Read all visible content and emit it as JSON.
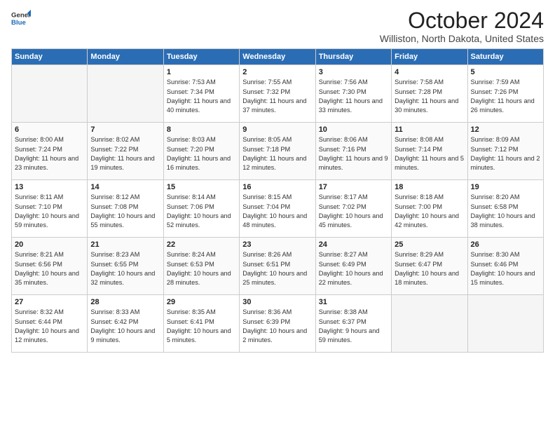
{
  "logo": {
    "text_general": "General",
    "text_blue": "Blue"
  },
  "title": "October 2024",
  "subtitle": "Williston, North Dakota, United States",
  "headers": [
    "Sunday",
    "Monday",
    "Tuesday",
    "Wednesday",
    "Thursday",
    "Friday",
    "Saturday"
  ],
  "weeks": [
    [
      {
        "day": "",
        "info": ""
      },
      {
        "day": "",
        "info": ""
      },
      {
        "day": "1",
        "info": "Sunrise: 7:53 AM\nSunset: 7:34 PM\nDaylight: 11 hours and 40 minutes."
      },
      {
        "day": "2",
        "info": "Sunrise: 7:55 AM\nSunset: 7:32 PM\nDaylight: 11 hours and 37 minutes."
      },
      {
        "day": "3",
        "info": "Sunrise: 7:56 AM\nSunset: 7:30 PM\nDaylight: 11 hours and 33 minutes."
      },
      {
        "day": "4",
        "info": "Sunrise: 7:58 AM\nSunset: 7:28 PM\nDaylight: 11 hours and 30 minutes."
      },
      {
        "day": "5",
        "info": "Sunrise: 7:59 AM\nSunset: 7:26 PM\nDaylight: 11 hours and 26 minutes."
      }
    ],
    [
      {
        "day": "6",
        "info": "Sunrise: 8:00 AM\nSunset: 7:24 PM\nDaylight: 11 hours and 23 minutes."
      },
      {
        "day": "7",
        "info": "Sunrise: 8:02 AM\nSunset: 7:22 PM\nDaylight: 11 hours and 19 minutes."
      },
      {
        "day": "8",
        "info": "Sunrise: 8:03 AM\nSunset: 7:20 PM\nDaylight: 11 hours and 16 minutes."
      },
      {
        "day": "9",
        "info": "Sunrise: 8:05 AM\nSunset: 7:18 PM\nDaylight: 11 hours and 12 minutes."
      },
      {
        "day": "10",
        "info": "Sunrise: 8:06 AM\nSunset: 7:16 PM\nDaylight: 11 hours and 9 minutes."
      },
      {
        "day": "11",
        "info": "Sunrise: 8:08 AM\nSunset: 7:14 PM\nDaylight: 11 hours and 5 minutes."
      },
      {
        "day": "12",
        "info": "Sunrise: 8:09 AM\nSunset: 7:12 PM\nDaylight: 11 hours and 2 minutes."
      }
    ],
    [
      {
        "day": "13",
        "info": "Sunrise: 8:11 AM\nSunset: 7:10 PM\nDaylight: 10 hours and 59 minutes."
      },
      {
        "day": "14",
        "info": "Sunrise: 8:12 AM\nSunset: 7:08 PM\nDaylight: 10 hours and 55 minutes."
      },
      {
        "day": "15",
        "info": "Sunrise: 8:14 AM\nSunset: 7:06 PM\nDaylight: 10 hours and 52 minutes."
      },
      {
        "day": "16",
        "info": "Sunrise: 8:15 AM\nSunset: 7:04 PM\nDaylight: 10 hours and 48 minutes."
      },
      {
        "day": "17",
        "info": "Sunrise: 8:17 AM\nSunset: 7:02 PM\nDaylight: 10 hours and 45 minutes."
      },
      {
        "day": "18",
        "info": "Sunrise: 8:18 AM\nSunset: 7:00 PM\nDaylight: 10 hours and 42 minutes."
      },
      {
        "day": "19",
        "info": "Sunrise: 8:20 AM\nSunset: 6:58 PM\nDaylight: 10 hours and 38 minutes."
      }
    ],
    [
      {
        "day": "20",
        "info": "Sunrise: 8:21 AM\nSunset: 6:56 PM\nDaylight: 10 hours and 35 minutes."
      },
      {
        "day": "21",
        "info": "Sunrise: 8:23 AM\nSunset: 6:55 PM\nDaylight: 10 hours and 32 minutes."
      },
      {
        "day": "22",
        "info": "Sunrise: 8:24 AM\nSunset: 6:53 PM\nDaylight: 10 hours and 28 minutes."
      },
      {
        "day": "23",
        "info": "Sunrise: 8:26 AM\nSunset: 6:51 PM\nDaylight: 10 hours and 25 minutes."
      },
      {
        "day": "24",
        "info": "Sunrise: 8:27 AM\nSunset: 6:49 PM\nDaylight: 10 hours and 22 minutes."
      },
      {
        "day": "25",
        "info": "Sunrise: 8:29 AM\nSunset: 6:47 PM\nDaylight: 10 hours and 18 minutes."
      },
      {
        "day": "26",
        "info": "Sunrise: 8:30 AM\nSunset: 6:46 PM\nDaylight: 10 hours and 15 minutes."
      }
    ],
    [
      {
        "day": "27",
        "info": "Sunrise: 8:32 AM\nSunset: 6:44 PM\nDaylight: 10 hours and 12 minutes."
      },
      {
        "day": "28",
        "info": "Sunrise: 8:33 AM\nSunset: 6:42 PM\nDaylight: 10 hours and 9 minutes."
      },
      {
        "day": "29",
        "info": "Sunrise: 8:35 AM\nSunset: 6:41 PM\nDaylight: 10 hours and 5 minutes."
      },
      {
        "day": "30",
        "info": "Sunrise: 8:36 AM\nSunset: 6:39 PM\nDaylight: 10 hours and 2 minutes."
      },
      {
        "day": "31",
        "info": "Sunrise: 8:38 AM\nSunset: 6:37 PM\nDaylight: 9 hours and 59 minutes."
      },
      {
        "day": "",
        "info": ""
      },
      {
        "day": "",
        "info": ""
      }
    ]
  ]
}
